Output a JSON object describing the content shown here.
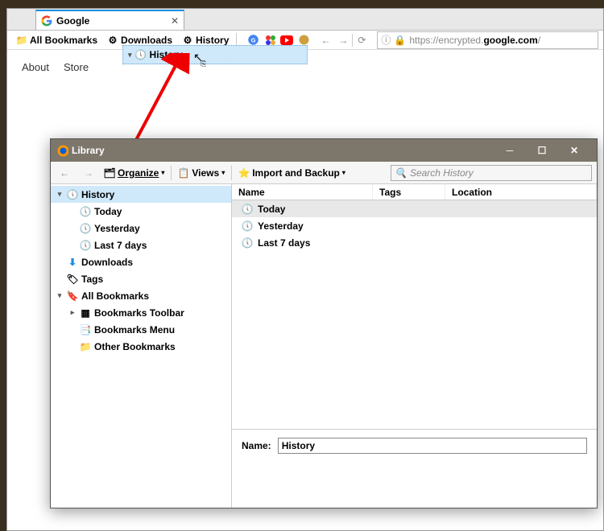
{
  "browser": {
    "tab": {
      "title": "Google",
      "close_glyph": "✕"
    },
    "bookmarks_bar": {
      "all_bookmarks": "All Bookmarks",
      "downloads": "Downloads",
      "history": "History"
    },
    "url": {
      "prefix": "https://",
      "mid": "encrypted.",
      "bold": "google.com",
      "suffix": "/"
    },
    "page_links": {
      "about": "About",
      "store": "Store"
    },
    "drag_label": "History"
  },
  "library": {
    "title": "Library",
    "toolbar": {
      "organize": "Organize",
      "views": "Views",
      "import": "Import and Backup",
      "search_placeholder": "Search History"
    },
    "tree": {
      "history": "History",
      "today": "Today",
      "yesterday": "Yesterday",
      "last7": "Last 7 days",
      "downloads": "Downloads",
      "tags": "Tags",
      "all_bookmarks": "All Bookmarks",
      "bm_toolbar": "Bookmarks Toolbar",
      "bm_menu": "Bookmarks Menu",
      "bm_other": "Other Bookmarks"
    },
    "columns": {
      "name": "Name",
      "tags": "Tags",
      "location": "Location"
    },
    "rows": {
      "today": "Today",
      "yesterday": "Yesterday",
      "last7": "Last 7 days"
    },
    "detail": {
      "name_label": "Name:",
      "name_value": "History"
    }
  }
}
